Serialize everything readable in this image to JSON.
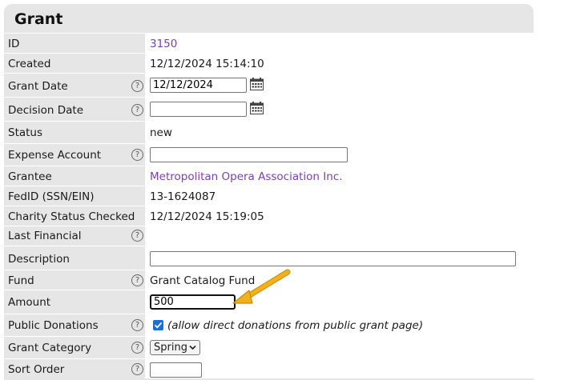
{
  "panel": {
    "title": "Grant"
  },
  "rows": [
    {
      "label": "ID",
      "value": "3150"
    },
    {
      "label": "Created",
      "value": "12/12/2024 15:14:10"
    },
    {
      "label": "Grant Date",
      "value": "12/12/2024",
      "help": "?"
    },
    {
      "label": "Decision Date",
      "value": "",
      "help": "?"
    },
    {
      "label": "Status",
      "value": "new"
    },
    {
      "label": "Expense Account",
      "value": "",
      "help": "?"
    },
    {
      "label": "Grantee",
      "value": "Metropolitan Opera Association Inc."
    },
    {
      "label": "FedID (SSN/EIN)",
      "value": "13-1624087"
    },
    {
      "label": "Charity Status Checked",
      "value": "12/12/2024 15:19:05"
    },
    {
      "label": "Last Financial",
      "value": "",
      "help": "?"
    },
    {
      "label": "Description",
      "value": ""
    },
    {
      "label": "Fund",
      "value": "Grant Catalog Fund",
      "help": "?"
    },
    {
      "label": "Amount",
      "value": "500"
    },
    {
      "label": "Public Donations",
      "value": "(allow direct donations from public grant page)",
      "help": "?",
      "checked": true
    },
    {
      "label": "Grant Category",
      "value": "Spring",
      "help": "?"
    },
    {
      "label": "Sort Order",
      "value": "",
      "help": "?"
    }
  ],
  "icons": {
    "help": "help-icon",
    "calendar": "calendar-icon",
    "arrow": "arrow-pointer"
  },
  "colors": {
    "link": "#7b3fb0",
    "arrow": "#f2b01e",
    "checkbox": "#1a6fd6"
  }
}
